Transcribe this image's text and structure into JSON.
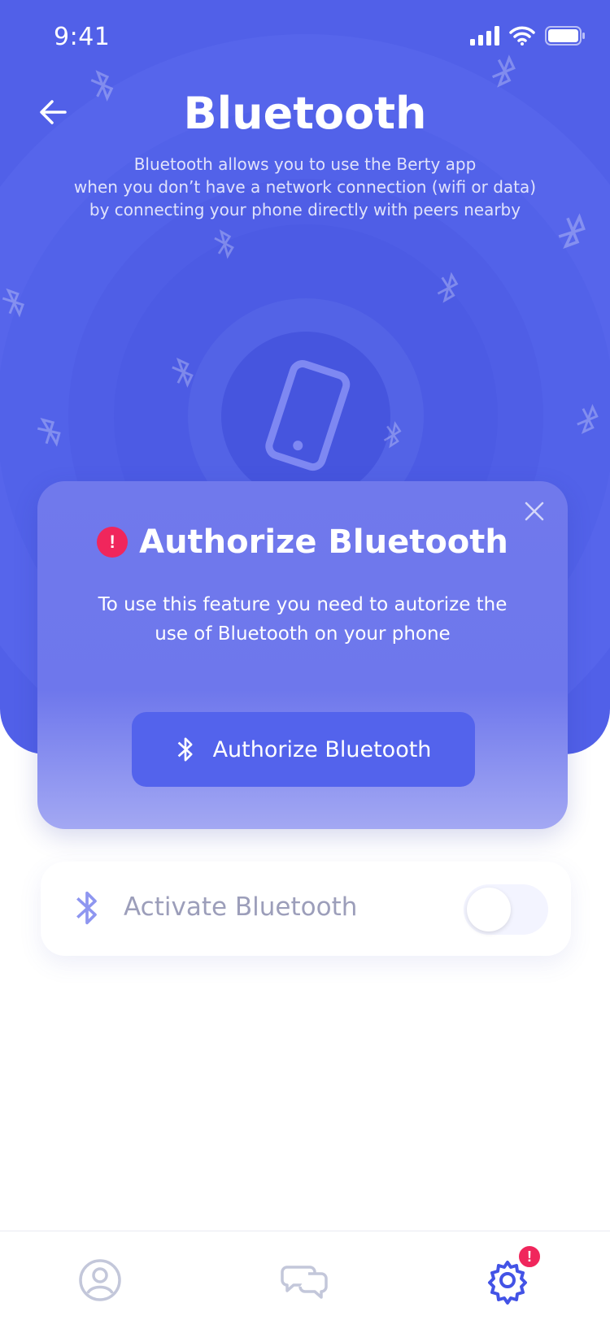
{
  "status_bar": {
    "time": "9:41"
  },
  "header": {
    "title": "Bluetooth",
    "subtitle_lines": [
      "Bluetooth allows you to use the Berty app",
      "when you don’t have a network connection (wifi or data)",
      "by connecting your phone directly with peers nearby"
    ]
  },
  "modal": {
    "title": "Authorize Bluetooth",
    "alert_symbol": "!",
    "text_lines": [
      "To use this feature you need to autorize the",
      "use of Bluetooth on your phone"
    ],
    "button_label": "Authorize Bluetooth"
  },
  "settings": {
    "activate_label": "Activate Bluetooth",
    "toggle_on": false
  },
  "tabbar": {
    "tabs": [
      "profile-icon",
      "chat-icon",
      "settings-icon"
    ],
    "settings_badge": "!"
  },
  "colors": {
    "primary": "#5160E8",
    "alert": "#F0265C",
    "muted_text": "#9C9EBA"
  }
}
